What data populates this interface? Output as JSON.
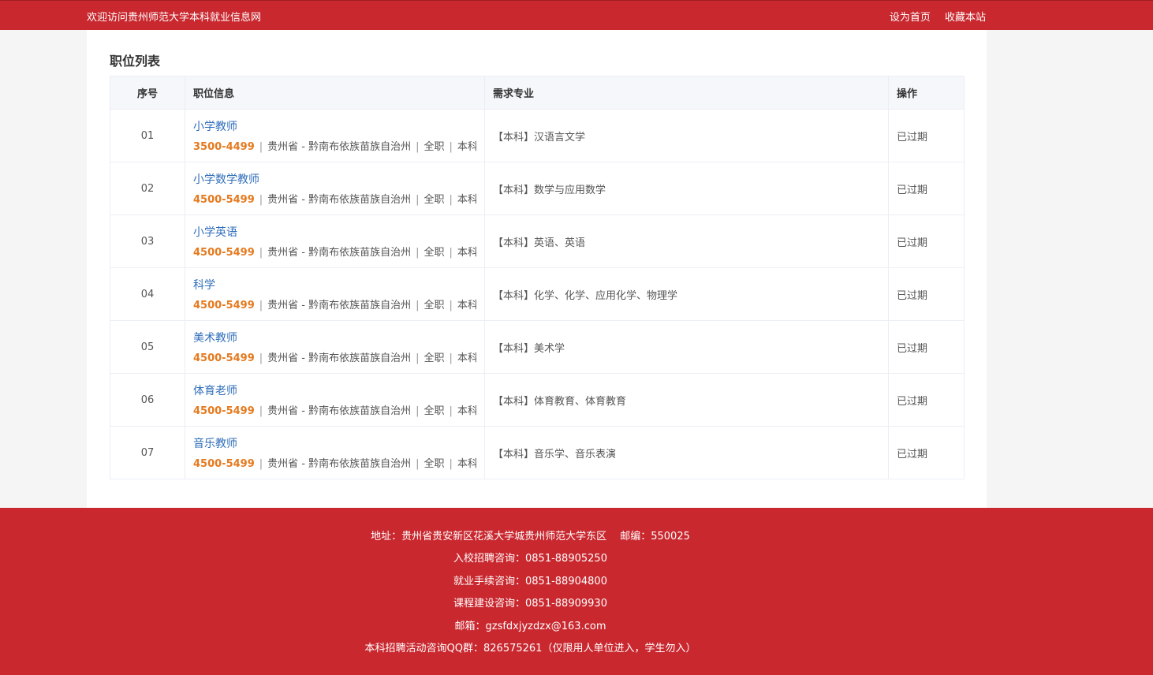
{
  "topbar": {
    "welcome": "欢迎访问贵州师范大学本科就业信息网",
    "set_home": "设为首页",
    "bookmark": "收藏本站"
  },
  "section_title": "职位列表",
  "table": {
    "headers": [
      "序号",
      "职位信息",
      "需求专业",
      "操作"
    ],
    "rows": [
      {
        "no": "01",
        "title": "小学教师",
        "salary": "3500-4499",
        "location": "贵州省 - 黔南布依族苗族自治州",
        "type": "全职",
        "edu": "本科",
        "major": "【本科】汉语言文学",
        "action": "已过期"
      },
      {
        "no": "02",
        "title": "小学数学教师",
        "salary": "4500-5499",
        "location": "贵州省 - 黔南布依族苗族自治州",
        "type": "全职",
        "edu": "本科",
        "major": "【本科】数学与应用数学",
        "action": "已过期"
      },
      {
        "no": "03",
        "title": "小学英语",
        "salary": "4500-5499",
        "location": "贵州省 - 黔南布依族苗族自治州",
        "type": "全职",
        "edu": "本科",
        "major": "【本科】英语、英语",
        "action": "已过期"
      },
      {
        "no": "04",
        "title": "科学",
        "salary": "4500-5499",
        "location": "贵州省 - 黔南布依族苗族自治州",
        "type": "全职",
        "edu": "本科",
        "major": "【本科】化学、化学、应用化学、物理学",
        "action": "已过期"
      },
      {
        "no": "05",
        "title": "美术教师",
        "salary": "4500-5499",
        "location": "贵州省 - 黔南布依族苗族自治州",
        "type": "全职",
        "edu": "本科",
        "major": "【本科】美术学",
        "action": "已过期"
      },
      {
        "no": "06",
        "title": "体育老师",
        "salary": "4500-5499",
        "location": "贵州省 - 黔南布依族苗族自治州",
        "type": "全职",
        "edu": "本科",
        "major": "【本科】体育教育、体育教育",
        "action": "已过期"
      },
      {
        "no": "07",
        "title": "音乐教师",
        "salary": "4500-5499",
        "location": "贵州省 - 黔南布依族苗族自治州",
        "type": "全职",
        "edu": "本科",
        "major": "【本科】音乐学、音乐表演",
        "action": "已过期"
      }
    ]
  },
  "footer": {
    "address": "地址：贵州省贵安新区花溪大学城贵州师范大学东区　 邮编：550025",
    "recruit": "入校招聘咨询：0851-88905250",
    "procedure": "就业手续咨询：0851-88904800",
    "course": "课程建设咨询：0851-88909930",
    "email": "邮箱：gzsfdxjyzdzx@163.com",
    "qq": "本科招聘活动咨询QQ群：826575261（仅限用人单位进入，学生勿入）"
  }
}
